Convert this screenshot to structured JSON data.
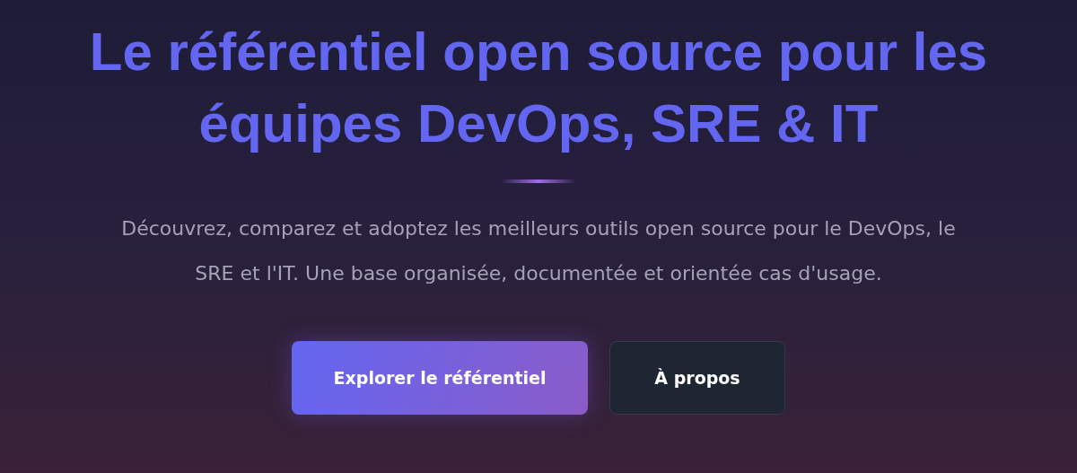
{
  "hero": {
    "title": "Le référentiel open source pour les équipes DevOps, SRE & IT",
    "description": "Découvrez, comparez et adoptez les meilleurs outils open source pour le DevOps, le SRE et l'IT. Une base organisée, documentée et orientée cas d'usage.",
    "buttons": [
      {
        "label": "Explorer le référentiel",
        "kind": "primary"
      },
      {
        "label": "À propos",
        "kind": "secondary"
      }
    ]
  }
}
